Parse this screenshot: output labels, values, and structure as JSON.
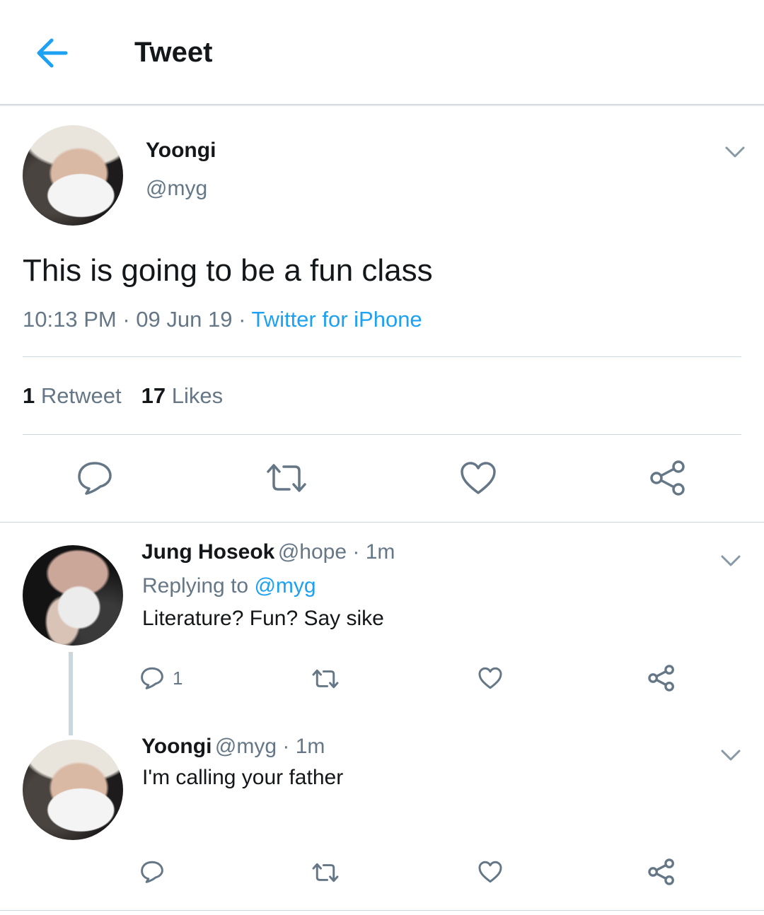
{
  "header": {
    "title": "Tweet",
    "back_icon": "arrow-left-icon",
    "accent": "#1da1f2"
  },
  "main_tweet": {
    "author_name": "Yoongi",
    "author_handle": "@myg",
    "text": "This is going to be a fun class",
    "time": "10:13 PM",
    "date": "09 Jun 19",
    "source": "Twitter for iPhone",
    "retweet_count": "1",
    "retweet_label": "Retweet",
    "like_count": "17",
    "like_label": "Likes"
  },
  "replies": [
    {
      "author_name": "Jung Hoseok",
      "author_handle": "@hope",
      "age": "1m",
      "replying_to_label": "Replying to",
      "replying_to_handle": "@myg",
      "text": "Literature? Fun? Say sike",
      "reply_count": "1"
    },
    {
      "author_name": "Yoongi",
      "author_handle": "@myg",
      "age": "1m",
      "text": "I'm calling your father"
    }
  ],
  "colors": {
    "text": "#14171a",
    "secondary": "#657786",
    "link": "#1da1f2",
    "divider": "#ccd6dd"
  }
}
